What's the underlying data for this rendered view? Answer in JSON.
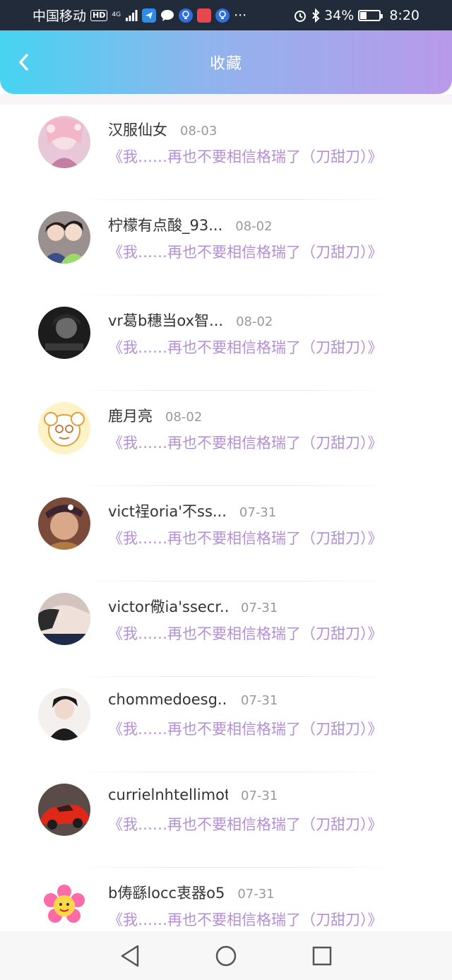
{
  "status_bar": {
    "carrier": "中国移动",
    "hd": "HD",
    "network": "4G",
    "more": "···",
    "battery": "34%",
    "time": "8:20"
  },
  "header": {
    "title": "收藏"
  },
  "items": [
    {
      "name": "汉服仙女",
      "date": "08-03",
      "title": "《我……再也不要相信格瑞了（刀甜刀）》"
    },
    {
      "name": "柠檬有点酸_93...",
      "date": "08-02",
      "title": "《我……再也不要相信格瑞了（刀甜刀）》"
    },
    {
      "name": "vr葛b穗当ox智...",
      "date": "08-02",
      "title": "《我……再也不要相信格瑞了（刀甜刀）》"
    },
    {
      "name": "鹿月亮",
      "date": "08-02",
      "title": "《我……再也不要相信格瑞了（刀甜刀）》"
    },
    {
      "name": "vict裎oria'不ss...",
      "date": "07-31",
      "title": "《我……再也不要相信格瑞了（刀甜刀）》"
    },
    {
      "name": "victor儆ia'ssecr...",
      "date": "07-31",
      "title": "《我……再也不要相信格瑞了（刀甜刀）》"
    },
    {
      "name": "chommedoesg...",
      "date": "07-31",
      "title": "《我……再也不要相信格瑞了（刀甜刀）》"
    },
    {
      "name": "currielnhtellimott",
      "date": "07-31",
      "title": "《我……再也不要相信格瑞了（刀甜刀）》"
    },
    {
      "name": "b俦繇locc衷器o5",
      "date": "07-31",
      "title": "《我……再也不要相信格瑞了（刀甜刀）》"
    }
  ],
  "colors": {
    "accent_text": "#b48fd8",
    "header_gradient_start": "#46d4f0",
    "header_gradient_end": "#b99aea"
  }
}
